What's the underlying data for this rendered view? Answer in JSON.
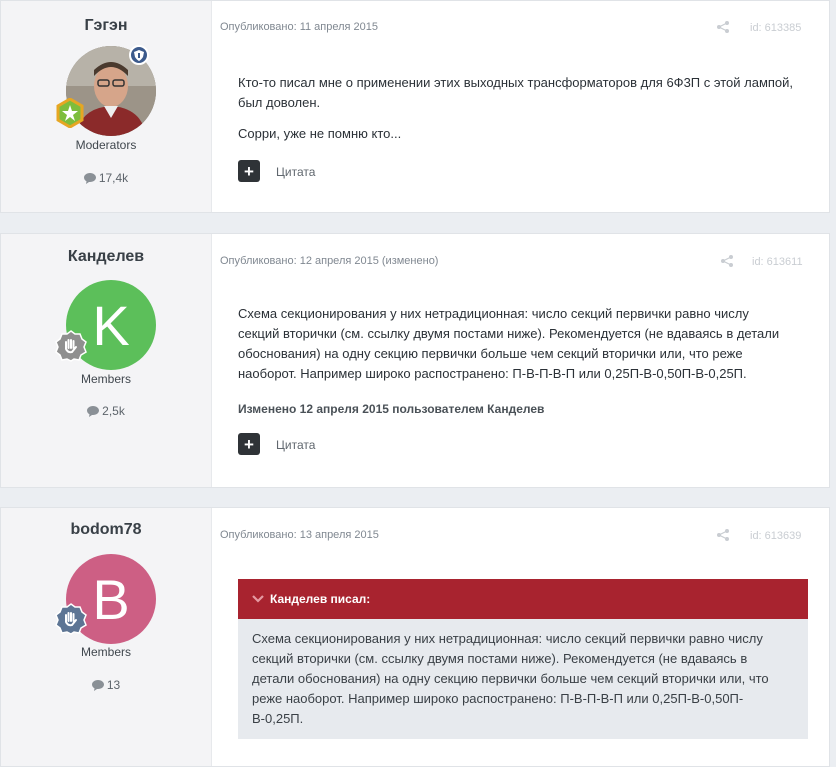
{
  "posts": [
    {
      "author": "Гэгэн",
      "group": "Moderators",
      "count": "17,4k",
      "date": "Опубликовано: 11 апреля 2015",
      "post_id": "id: 613385",
      "text_lines": [
        "Кто-то писал мне о применении этих выходных трансформаторов для 6Ф3П с этой лампой,",
        "был доволен."
      ],
      "text_extra": "Сорри, уже не помню кто...",
      "quote_label": "Цитата"
    },
    {
      "author": "Канделев",
      "group": "Members",
      "count": "2,5k",
      "avatar_letter": "K",
      "date": "Опубликовано: 12 апреля 2015 (изменено)",
      "post_id": "id: 613611",
      "text_lines": [
        "Схема секционирования у них нетрадиционная: число секций первички равно числу",
        "секций вторички (см. ссылку двумя постами ниже). Рекомендуется (не вдаваясь в детали",
        "обоснования) на одну секцию первички больше чем секций вторички или, что реже",
        "наоборот. Например широко распостранено: П-В-П-В-П или 0,25П-В-0,50П-В-0,25П."
      ],
      "edited_note": "Изменено 12 апреля 2015 пользователем Канделев",
      "quote_label": "Цитата"
    },
    {
      "author": "bodom78",
      "group": "Members",
      "count": "13",
      "avatar_letter": "B",
      "date": "Опубликовано: 13 апреля 2015",
      "post_id": "id: 613639",
      "quote_header": "Канделев писал:",
      "quote_lines": [
        "Схема секционирования у них нетрадиционная: число секций первички равно числу",
        "секций вторички (см. ссылку двумя постами ниже). Рекомендуется (не вдаваясь в",
        "детали обоснования) на одну секцию первички больше чем секций вторички или, что",
        "реже наоборот. Например широко распостранено: П-В-П-В-П или 0,25П-В-0,50П-",
        "В-0,25П."
      ]
    }
  ],
  "colors": {
    "avatar_k": "#5cbf5a",
    "avatar_b": "#cd5f84",
    "quote_header": "#a8232f",
    "moderator_badge": "#3c5a8c"
  },
  "icons": {
    "count": "speech-bubble-icon",
    "share": "share-icon",
    "quote_button": "plus-icon",
    "rank": "rank-badge-icon",
    "quote_chevron": "chevron-down-icon"
  }
}
